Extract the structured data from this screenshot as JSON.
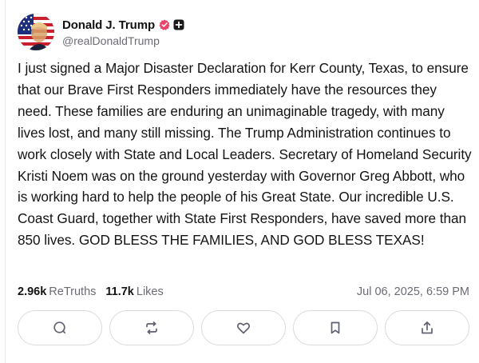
{
  "post": {
    "author": {
      "display_name": "Donald J. Trump",
      "handle": "@realDonaldTrump",
      "avatar_icon": "flag-avatar",
      "verified_icon": "verified-badge-icon",
      "verified_color": "#e8456b",
      "plus_icon": "plus-badge-icon"
    },
    "text": "I just signed a Major Disaster Declaration for Kerr County, Texas, to ensure that our Brave First Responders immediately have the resources they need. These families are enduring an unimaginable tragedy, with many lives lost, and many still missing. The Trump Administration continues to work closely with State and Local Leaders. Secretary of Homeland Security Kristi Noem was on the ground yesterday with Governor Greg Abbott, who is working hard to help the people of his Great State. Our incredible U.S. Coast Guard, together with State First Responders, have saved more than 850 lives. GOD BLESS THE FAMILIES, AND GOD BLESS TEXAS!",
    "stats": {
      "retruths_count": "2.96k",
      "retruths_label": "ReTruths",
      "likes_count": "11.7k",
      "likes_label": "Likes"
    },
    "timestamp": "Jul 06, 2025, 6:59 PM",
    "actions": [
      {
        "name": "reply",
        "icon": "comment-icon"
      },
      {
        "name": "retruth",
        "icon": "repost-icon"
      },
      {
        "name": "like",
        "icon": "heart-icon"
      },
      {
        "name": "bookmark",
        "icon": "bookmark-icon"
      },
      {
        "name": "share",
        "icon": "share-icon"
      }
    ],
    "colors": {
      "text": "#141414",
      "muted": "#6b6b76",
      "border": "#dadadf",
      "icon": "#5f6070"
    }
  }
}
